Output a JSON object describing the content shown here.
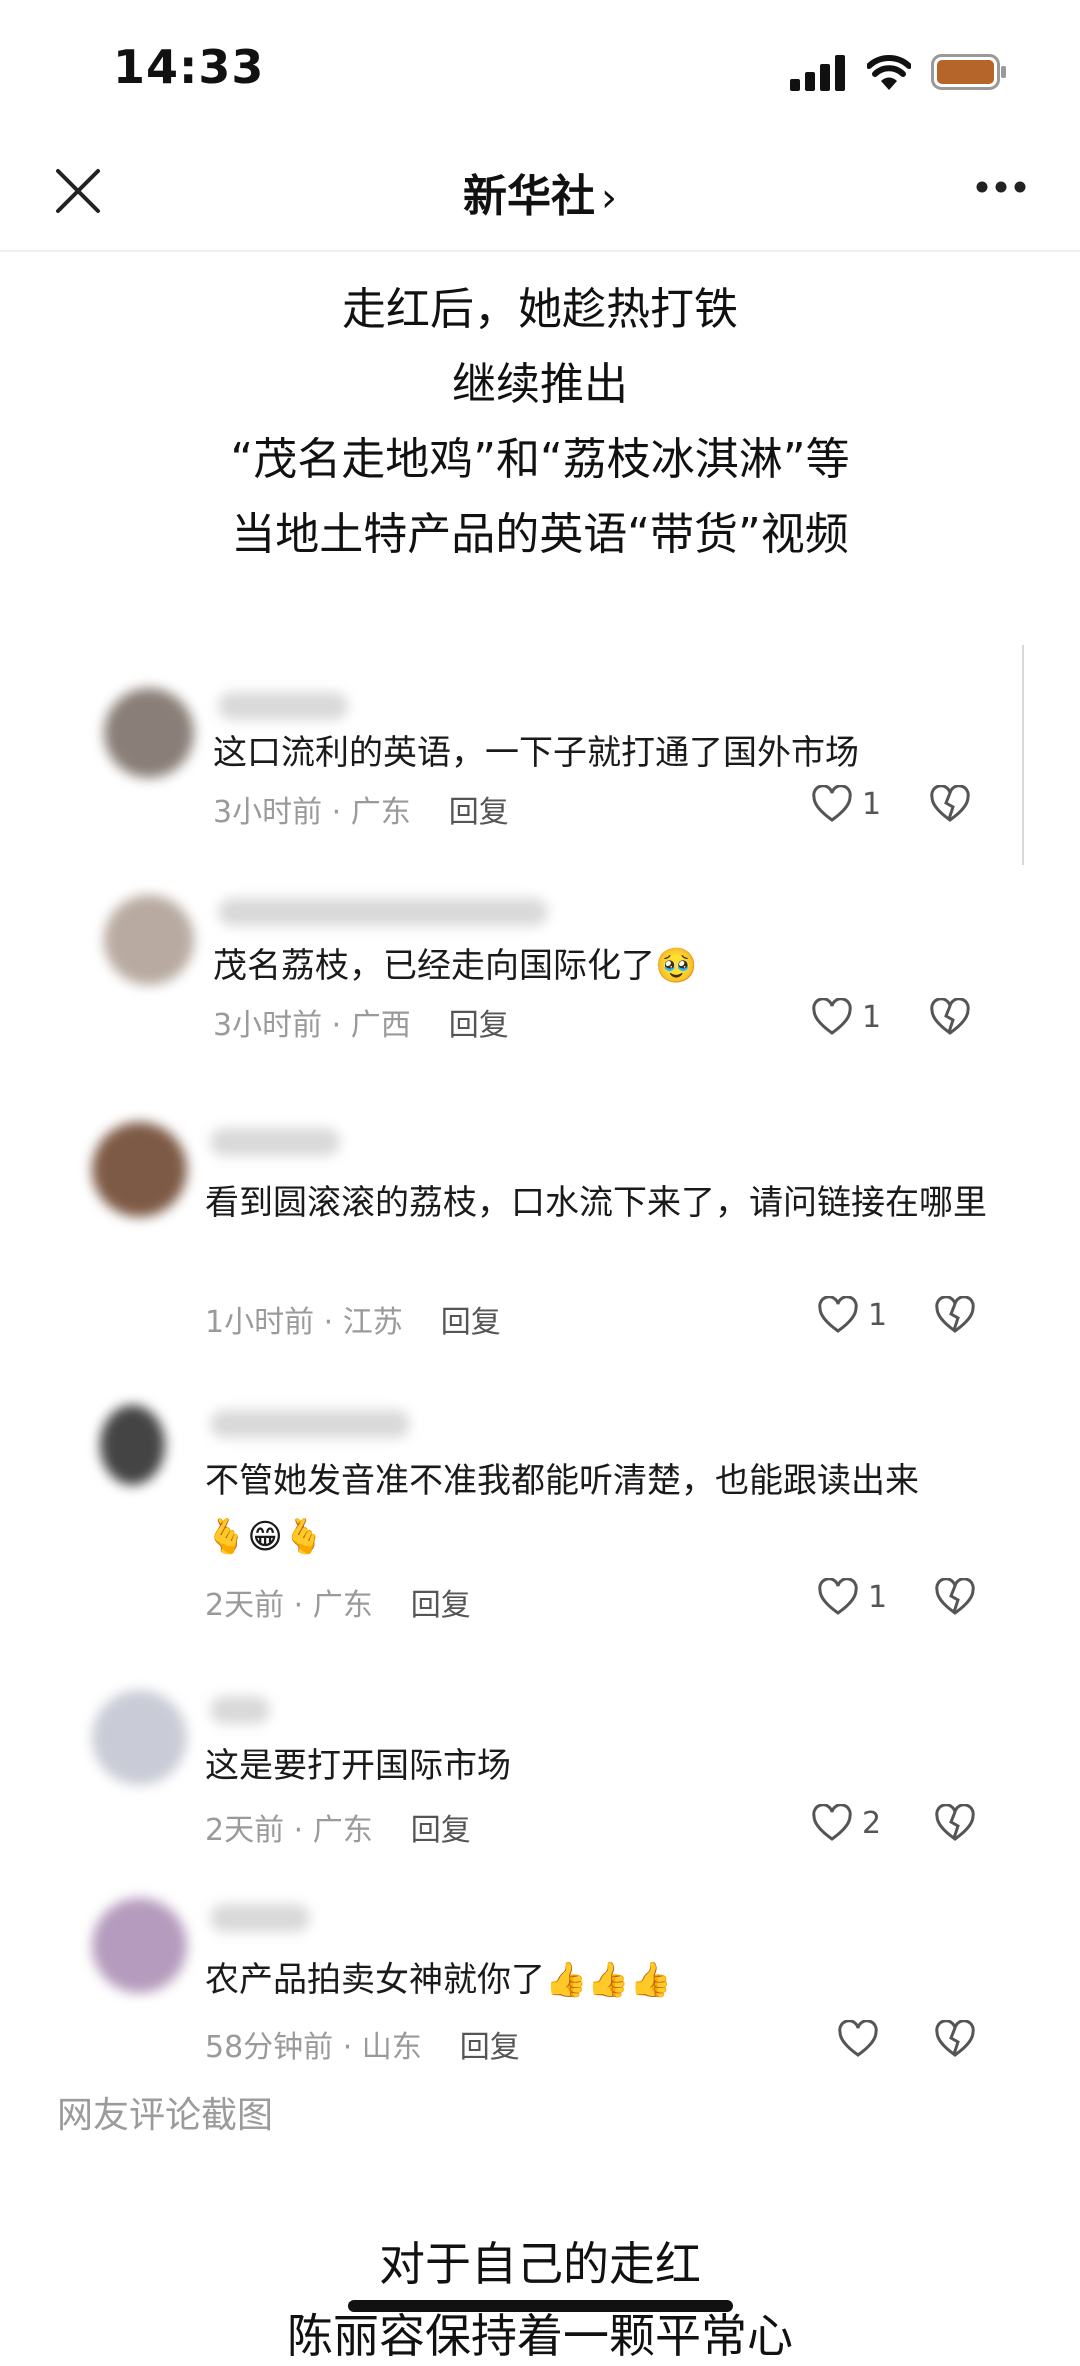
{
  "status": {
    "time": "14:33"
  },
  "nav": {
    "title": "新华社",
    "chevron": "›"
  },
  "headline": {
    "line1": "走红后，她趁热打铁",
    "line2": "继续推出",
    "line3": "“茂名走地鸡”和“荔枝冰淇淋”等",
    "line4": "当地土特产品的英语“带货”视频"
  },
  "comments": [
    {
      "text": "这口流利的英语，一下子就打通了国外市场",
      "time": "3小时前",
      "location": "广东",
      "reply": "回复",
      "likes": "1"
    },
    {
      "text": "茂名荔枝，已经走向国际化了",
      "emoji": "🥹",
      "time": "3小时前",
      "location": "广西",
      "reply": "回复",
      "likes": "1"
    },
    {
      "text": "看到圆滚滚的荔枝，口水流下来了，请问链接在哪里",
      "time": "1小时前",
      "location": "江苏",
      "reply": "回复",
      "likes": "1"
    },
    {
      "text": "不管她发音准不准我都能听清楚，也能跟读出来",
      "emoji": "🫰😁🫰",
      "time": "2天前",
      "location": "广东",
      "reply": "回复",
      "likes": "1"
    },
    {
      "text": "这是要打开国际市场",
      "time": "2天前",
      "location": "广东",
      "reply": "回复",
      "likes": "2"
    },
    {
      "text": "农产品拍卖女神就你了",
      "emoji": "👍👍👍",
      "time": "58分钟前",
      "location": "山东",
      "reply": "回复",
      "likes": ""
    }
  ],
  "caption": "网友评论截图",
  "footer": {
    "line1": "对于自己的走红",
    "line2": "陈丽容保持着一颗平常心"
  },
  "icons": {
    "signal": "signal-icon",
    "wifi": "wifi-icon",
    "battery": "battery-icon",
    "close": "close-icon",
    "more": "more-icon",
    "like": "heart-icon",
    "dislike": "broken-heart-icon"
  },
  "colors": {
    "battery": "#b5652a",
    "meta": "#9a9a9a",
    "background": "#ffffff"
  }
}
